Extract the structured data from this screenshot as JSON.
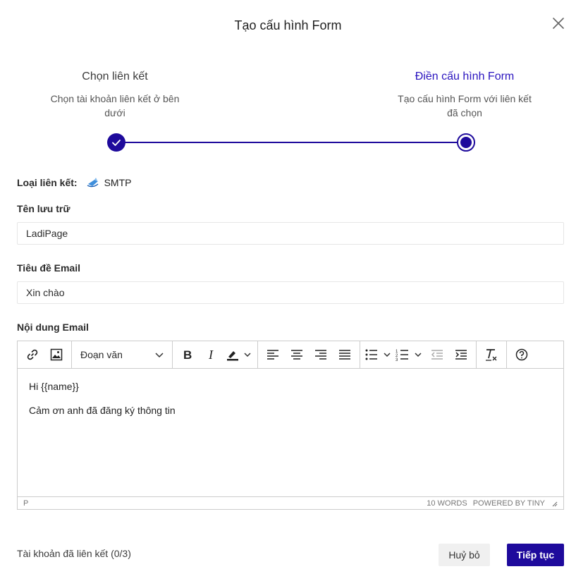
{
  "modal": {
    "title": "Tạo cấu hình Form"
  },
  "stepper": {
    "steps": [
      {
        "title": "Chọn liên kết",
        "description": "Chọn tài khoản liên kết ở bên dưới",
        "status": "completed"
      },
      {
        "title": "Điền cấu hình Form",
        "description": "Tạo cấu hình Form với liên kết đã chọn",
        "status": "active"
      }
    ]
  },
  "form": {
    "link_type_label": "Loại liên kết:",
    "link_type_value": "SMTP",
    "storage_name_label": "Tên lưu trữ",
    "storage_name_value": "LadiPage",
    "email_subject_label": "Tiêu đề Email",
    "email_subject_value": "Xin chào",
    "email_body_label": "Nội dung Email"
  },
  "editor": {
    "block_format": "Đoạn văn",
    "content": [
      "Hi {{name}}",
      "Cảm ơn anh đã đăng ký thông tin"
    ],
    "status_path": "P",
    "word_count": "10 WORDS",
    "powered_by": "POWERED BY TINY",
    "icons": [
      "link-icon",
      "image-icon",
      "bold-icon",
      "italic-icon",
      "highlight-icon",
      "align-left-icon",
      "align-center-icon",
      "align-right-icon",
      "align-justify-icon",
      "bullet-list-icon",
      "numbered-list-icon",
      "outdent-icon",
      "indent-icon",
      "clear-format-icon",
      "help-icon"
    ]
  },
  "footer": {
    "linked_accounts": "Tài khoản đã liên kết (0/3)",
    "cancel_label": "Huỷ bỏ",
    "next_label": "Tiếp tục"
  },
  "colors": {
    "primary": "#1e0a9c",
    "active_step_text": "#2a14bf"
  }
}
